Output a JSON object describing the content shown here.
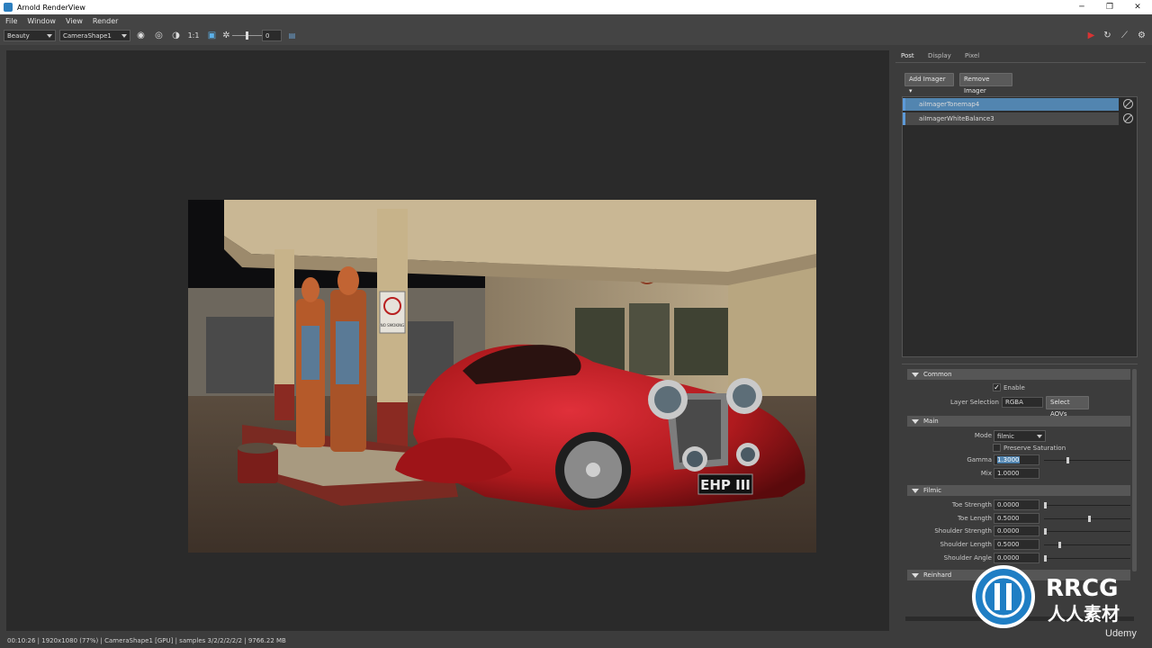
{
  "window": {
    "title": "Arnold RenderView"
  },
  "menu": [
    "File",
    "Window",
    "View",
    "Render"
  ],
  "toolbar": {
    "aov_select": "Beauty",
    "camera_select": "CameraShape1",
    "ratio_label": "1:1",
    "exposure_value": "0"
  },
  "tabs": [
    "Post",
    "Display",
    "Pixel"
  ],
  "buttons": {
    "add_imager": "Add Imager",
    "remove_imager": "Remove Imager"
  },
  "imagers": [
    {
      "name": "aiImagerTonemap4",
      "selected": true
    },
    {
      "name": "aiImagerWhiteBalance3",
      "selected": false
    }
  ],
  "attributes": {
    "common": {
      "header": "Common",
      "enable_label": "Enable",
      "enabled": true,
      "layer_selection_label": "Layer Selection",
      "layer_selection_value": "RGBA",
      "select_aovs_label": "Select AOVs"
    },
    "main": {
      "header": "Main",
      "mode_label": "Mode",
      "mode_value": "filmic",
      "preserve_saturation_label": "Preserve Saturation",
      "gamma_label": "Gamma",
      "gamma_value": "1.3000",
      "gamma_level": 0.3,
      "mix_label": "Mix",
      "mix_value": "1.0000"
    },
    "filmic": {
      "header": "Filmic",
      "toe_strength_label": "Toe Strength",
      "toe_strength_value": "0.0000",
      "toe_length_label": "Toe Length",
      "toe_length_value": "0.5000",
      "shoulder_strength_label": "Shoulder Strength",
      "shoulder_strength_value": "0.0000",
      "shoulder_length_label": "Shoulder Length",
      "shoulder_length_value": "0.5000",
      "shoulder_angle_label": "Shoulder Angle",
      "shoulder_angle_value": "0.0000"
    },
    "reinhard": {
      "header": "Reinhard"
    }
  },
  "render_image": {
    "license_plate": "EHP III",
    "sign_text": "NO SMOKING"
  },
  "status": "00:10:26 | 1920x1080 (77%) | CameraShape1 [GPU] | samples 3/2/2/2/2/2 | 9766.22 MB",
  "watermark": {
    "brand": "RRCG",
    "sub": "人人素材",
    "site": "Udemy"
  },
  "colors": {
    "selection": "#5285b0",
    "panel_bg": "#3c3c3c",
    "viewport_bg": "#2a2a2a",
    "car_red": "#b01a1e"
  }
}
